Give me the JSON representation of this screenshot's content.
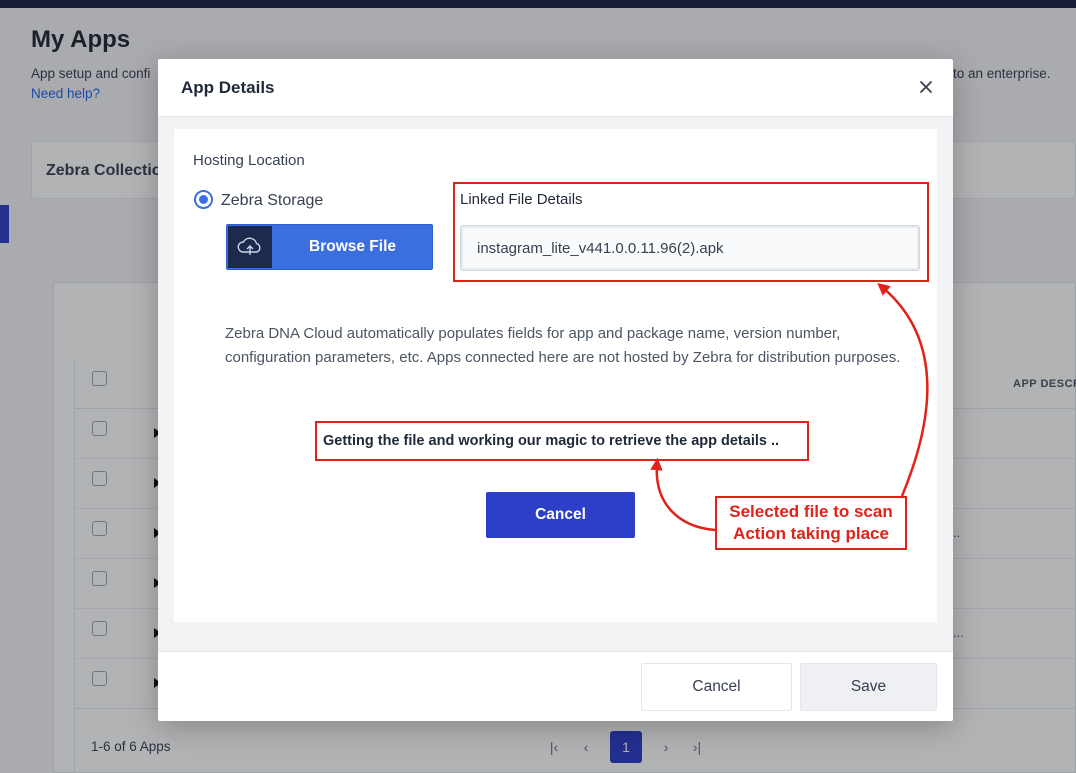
{
  "page": {
    "title": "My Apps",
    "description_left": "App setup and confi",
    "description_right": "to an enterprise.",
    "help_link": "Need help?",
    "collection_tab": "Zebra Collection",
    "table": {
      "app_description_header": "APP DESCR",
      "rows": [
        {
          "extra": ""
        },
        {
          "extra": ""
        },
        {
          "extra": ".."
        },
        {
          "extra": ""
        },
        {
          "extra": "..."
        },
        {
          "extra": ""
        }
      ]
    },
    "pagination": {
      "count": "1-6 of 6 Apps",
      "first": "|‹",
      "prev": "‹",
      "current": "1",
      "next": "›",
      "last": "›|"
    }
  },
  "dialog": {
    "title": "App Details",
    "close_icon": "close-icon",
    "hosting_location_label": "Hosting Location",
    "storage_option": "Zebra Storage",
    "browse_button": "Browse File",
    "browse_icon": "cloud-upload-icon",
    "linked_file_label": "Linked File Details",
    "linked_file_value": "instagram_lite_v441.0.0.11.96(2).apk",
    "info_text": "Zebra DNA Cloud automatically populates fields for app and package name, version number, configuration parameters, etc. Apps connected here are not hosted by Zebra for distribution purposes.",
    "status_text": "Getting the file and working our magic to retrieve the app details  ..",
    "cancel_button": "Cancel",
    "annotation_line1": "Selected file to scan",
    "annotation_line2": "Action taking place",
    "footer_cancel": "Cancel",
    "footer_save": "Save"
  },
  "colors": {
    "primary": "#2d3fc7",
    "browse_blue": "#3b6fe0",
    "annotation_red": "#e0231a",
    "header_dark": "#1c2348"
  }
}
